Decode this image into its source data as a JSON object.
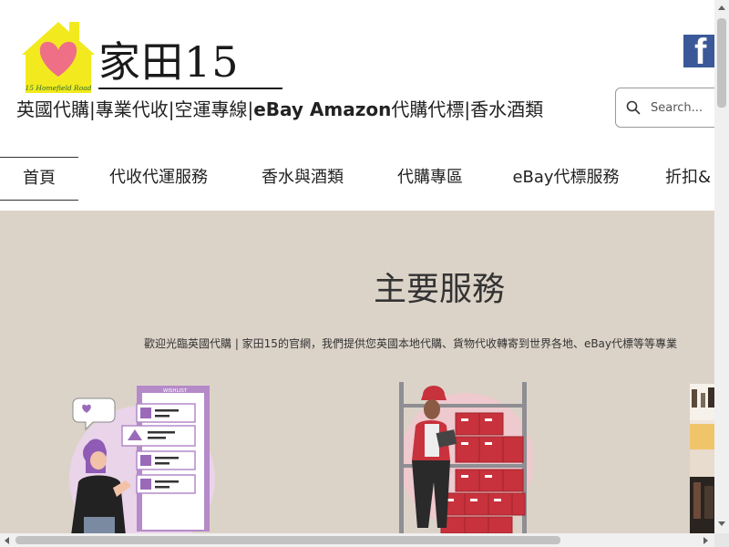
{
  "header": {
    "site_title": "家田15",
    "logo_caption": "15 Homefield Road",
    "tagline_part1": "英國代購|專業代收|空運專線|",
    "tagline_bold": "eBay Amazon",
    "tagline_part2": "代購代標|香水酒類",
    "facebook_glyph": "f",
    "search": {
      "placeholder": "Search..."
    }
  },
  "nav": {
    "items": [
      {
        "label": "首頁"
      },
      {
        "label": "代收代運服務"
      },
      {
        "label": "香水與酒類"
      },
      {
        "label": "代購專區"
      },
      {
        "label": "eBay代標服務"
      },
      {
        "label": "折扣&"
      }
    ]
  },
  "hero": {
    "title": "主要服務",
    "text": "歡迎光臨英國代購 | 家田15的官網，我們提供您英國本地代購、貨物代收轉寄到世界各地、eBay代標等等專業",
    "wishlist_tag": "WISHLIST"
  },
  "colors": {
    "hero_bg": "#dcd3c8",
    "facebook_blue": "#3b5998",
    "logo_yellow": "#f2ea1f",
    "heart_pink": "#ee6f86",
    "box_red": "#c8323c"
  }
}
